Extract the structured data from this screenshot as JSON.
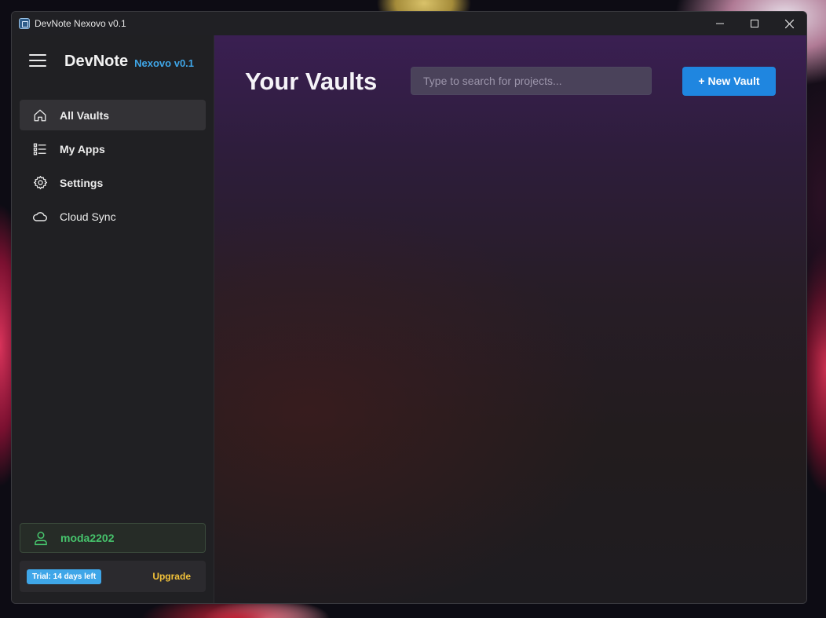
{
  "window": {
    "title": "DevNote Nexovo v0.1"
  },
  "sidebar": {
    "brand": "DevNote",
    "version": "Nexovo v0.1",
    "items": [
      {
        "label": "All Vaults",
        "icon": "home-icon",
        "active": true
      },
      {
        "label": "My Apps",
        "icon": "list-icon",
        "active": false
      },
      {
        "label": "Settings",
        "icon": "gear-icon",
        "active": false
      },
      {
        "label": "Cloud Sync",
        "icon": "cloud-icon",
        "active": false
      }
    ],
    "user": {
      "name": "moda2202",
      "icon": "user-icon"
    },
    "trial": {
      "badge": "Trial: 14 days left",
      "upgrade": "Upgrade"
    }
  },
  "main": {
    "title": "Your Vaults",
    "search": {
      "placeholder": "Type to search for projects...",
      "value": ""
    },
    "new_vault_label": "+ New Vault"
  },
  "colors": {
    "accent_blue": "#1f86e0",
    "version_blue": "#3fa6e8",
    "user_green": "#46c36c",
    "upgrade_yellow": "#f2c23a"
  }
}
